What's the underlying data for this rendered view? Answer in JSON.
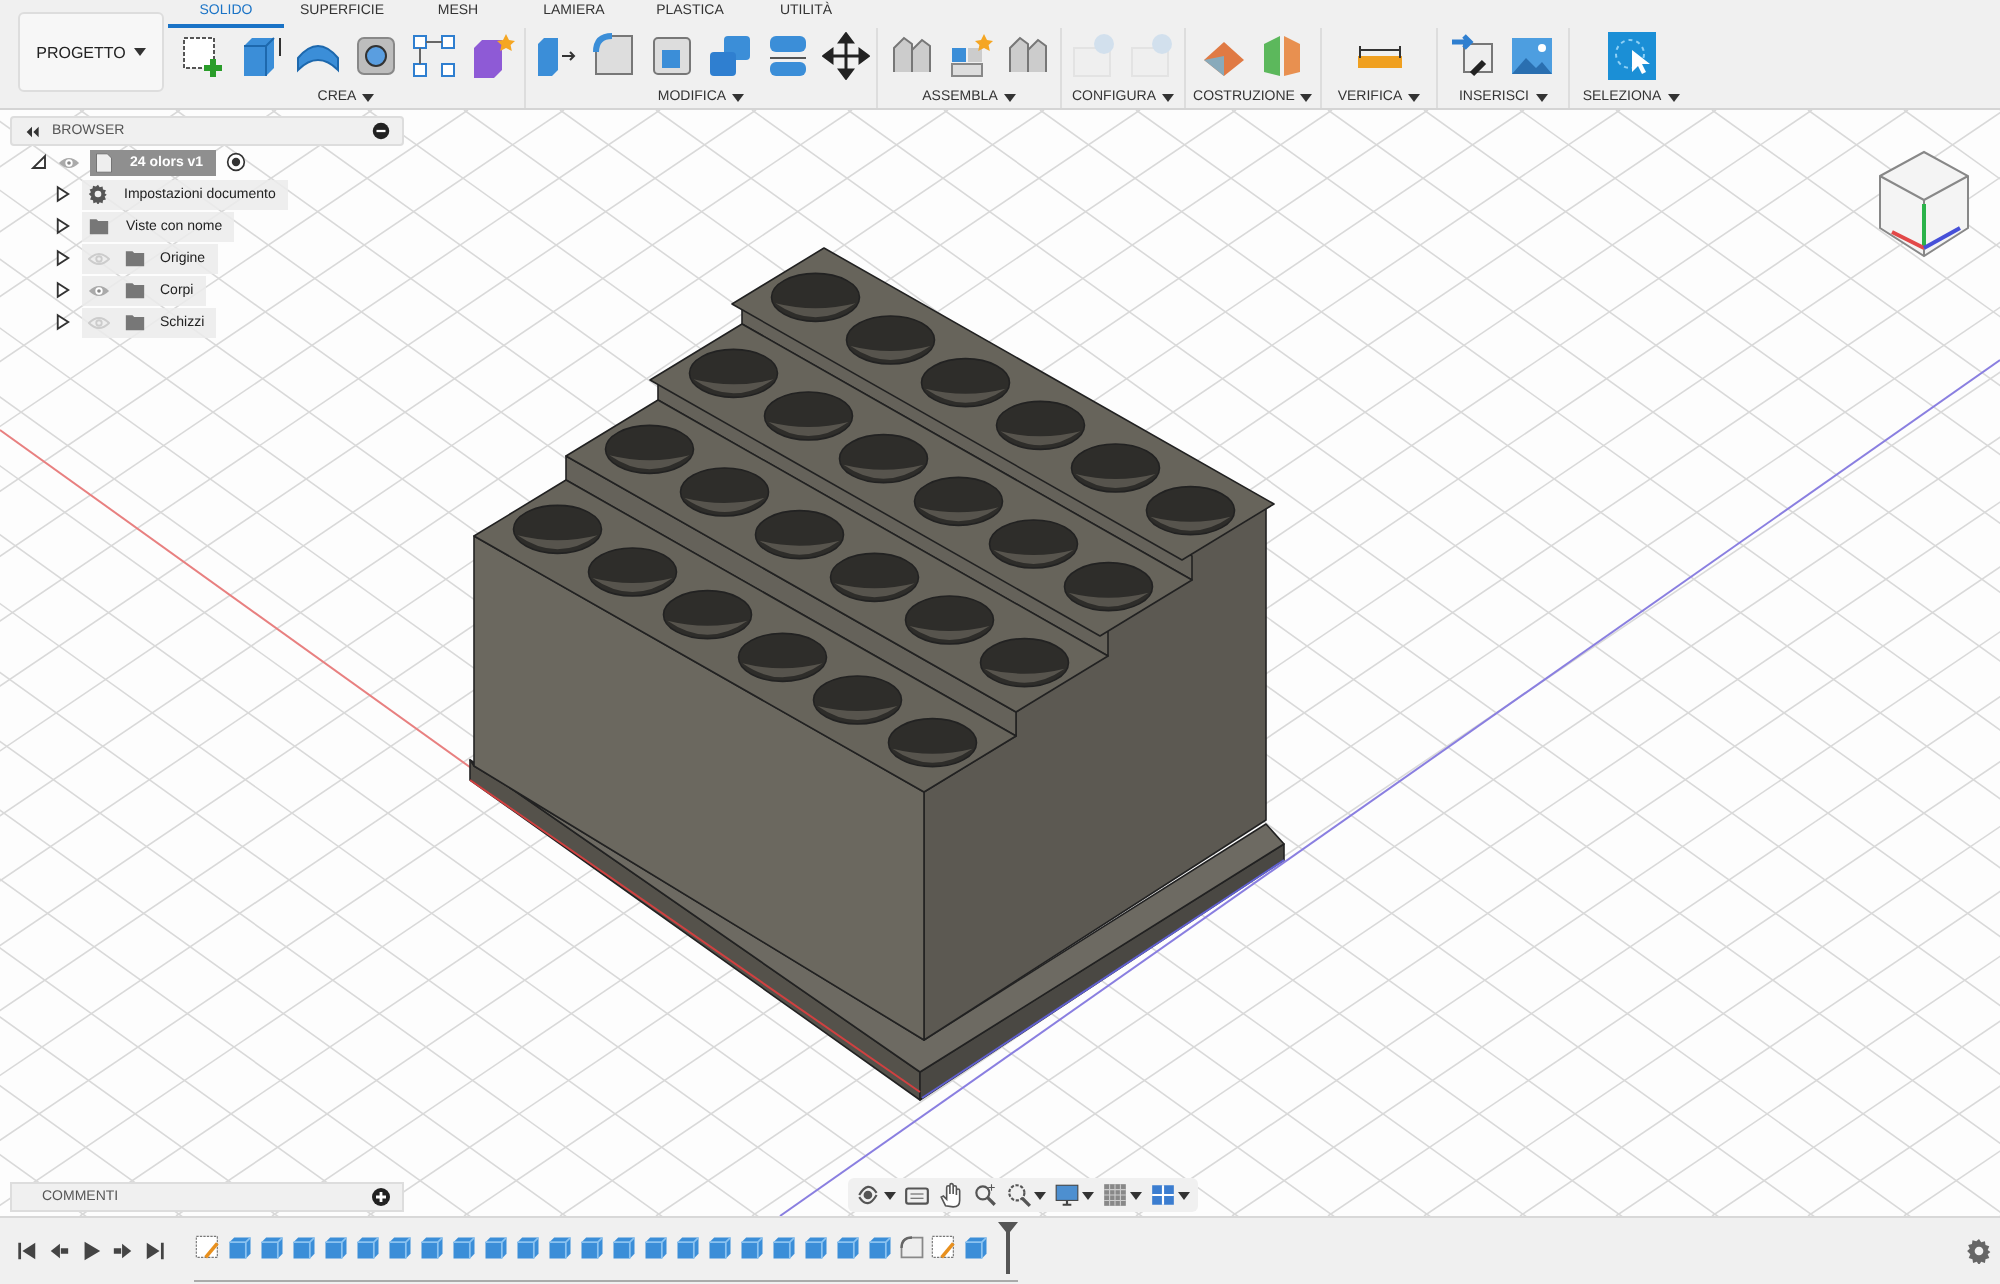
{
  "toolbar": {
    "project_button": "PROGETTO",
    "tabs": [
      {
        "label": "SOLIDO",
        "selected": true
      },
      {
        "label": "SUPERFICIE",
        "selected": false
      },
      {
        "label": "MESH",
        "selected": false
      },
      {
        "label": "LAMIERA",
        "selected": false
      },
      {
        "label": "PLASTICA",
        "selected": false
      },
      {
        "label": "UTILITÀ",
        "selected": false
      }
    ],
    "groups": [
      {
        "label": "CREA",
        "disabled": false
      },
      {
        "label": "MODIFICA",
        "disabled": false
      },
      {
        "label": "ASSEMBLA",
        "disabled": false
      },
      {
        "label": "CONFIGURA",
        "disabled": true
      },
      {
        "label": "COSTRUZIONE",
        "disabled": false
      },
      {
        "label": "VERIFICA",
        "disabled": false
      },
      {
        "label": "INSERISCI",
        "disabled": false
      },
      {
        "label": "SELEZIONA",
        "disabled": false
      }
    ]
  },
  "browser": {
    "title": "BROWSER",
    "root": {
      "label": "24 olors v1",
      "expanded": true,
      "visible": true,
      "children": [
        {
          "label": "Impostazioni documento",
          "kind": "settings",
          "expanded": false
        },
        {
          "label": "Viste con nome",
          "kind": "folder",
          "expanded": false
        },
        {
          "label": "Origine",
          "kind": "layer",
          "visible": false,
          "expanded": false
        },
        {
          "label": "Corpi",
          "kind": "layer",
          "visible": true,
          "expanded": false
        },
        {
          "label": "Schizzi",
          "kind": "layer",
          "visible": false,
          "expanded": false
        }
      ]
    }
  },
  "comments": {
    "title": "COMMENTI"
  },
  "timeline": {
    "features": [
      {
        "kind": "sketch"
      },
      {
        "kind": "extrude"
      },
      {
        "kind": "extrude"
      },
      {
        "kind": "extrude"
      },
      {
        "kind": "extrude"
      },
      {
        "kind": "extrude"
      },
      {
        "kind": "extrude"
      },
      {
        "kind": "extrude"
      },
      {
        "kind": "extrude"
      },
      {
        "kind": "extrude"
      },
      {
        "kind": "extrude"
      },
      {
        "kind": "extrude"
      },
      {
        "kind": "extrude"
      },
      {
        "kind": "extrude"
      },
      {
        "kind": "extrude"
      },
      {
        "kind": "extrude"
      },
      {
        "kind": "extrude"
      },
      {
        "kind": "extrude"
      },
      {
        "kind": "extrude"
      },
      {
        "kind": "extrude"
      },
      {
        "kind": "extrude"
      },
      {
        "kind": "extrude"
      },
      {
        "kind": "fillet"
      },
      {
        "kind": "sketch"
      },
      {
        "kind": "extrude"
      }
    ]
  }
}
